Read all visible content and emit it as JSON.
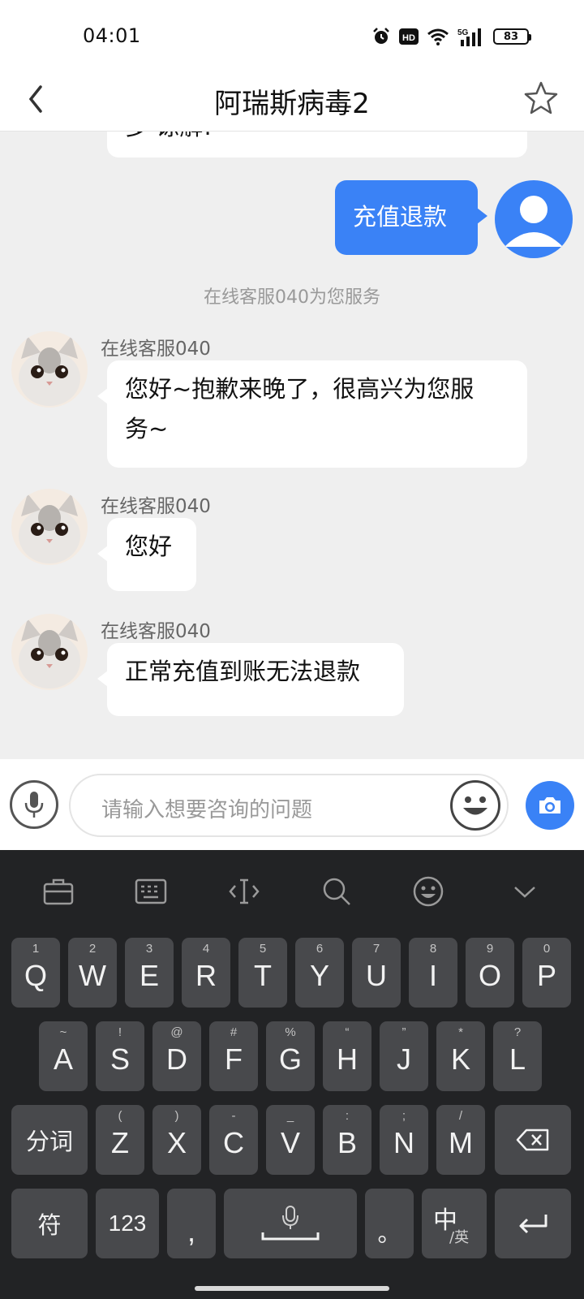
{
  "status_bar": {
    "time": "04:01",
    "icons": [
      "alarm-icon",
      "hd-icon",
      "wifi-icon",
      "signal-5g-icon"
    ],
    "network_label": "5G",
    "hd_label": "HD",
    "battery": "83"
  },
  "header": {
    "title": "阿瑞斯病毒2",
    "back_icon": "chevron-left-icon",
    "favorite_icon": "star-outline-icon"
  },
  "chat": {
    "partial_text": "多 谅解!",
    "user_message": "充值退款",
    "system_notice": "在线客服040为您服务",
    "messages": [
      {
        "sender": "在线客服040",
        "text_line1": "您好~抱歉来晚了，很高兴为您服",
        "text_line2": "务~"
      },
      {
        "sender": "在线客服040",
        "text": "您好"
      },
      {
        "sender": "在线客服040",
        "text": "正常充值到账无法退款"
      }
    ]
  },
  "input_bar": {
    "placeholder": "请输入想要咨询的问题",
    "voice_icon": "microphone-icon",
    "emoji_icon": "smiley-icon",
    "camera_icon": "camera-icon"
  },
  "keyboard": {
    "toolbar": [
      "toolbox-icon",
      "keyboard-icon",
      "cursor-icon",
      "search-icon",
      "emoji-icon",
      "collapse-icon"
    ],
    "row1": [
      {
        "k": "Q",
        "h": "1"
      },
      {
        "k": "W",
        "h": "2"
      },
      {
        "k": "E",
        "h": "3"
      },
      {
        "k": "R",
        "h": "4"
      },
      {
        "k": "T",
        "h": "5"
      },
      {
        "k": "Y",
        "h": "6"
      },
      {
        "k": "U",
        "h": "7"
      },
      {
        "k": "I",
        "h": "8"
      },
      {
        "k": "O",
        "h": "9"
      },
      {
        "k": "P",
        "h": "0"
      }
    ],
    "row2": [
      {
        "k": "A",
        "h": "~"
      },
      {
        "k": "S",
        "h": "!"
      },
      {
        "k": "D",
        "h": "@"
      },
      {
        "k": "F",
        "h": "#"
      },
      {
        "k": "G",
        "h": "%"
      },
      {
        "k": "H",
        "h": "“"
      },
      {
        "k": "J",
        "h": "”"
      },
      {
        "k": "K",
        "h": "*"
      },
      {
        "k": "L",
        "h": "?"
      }
    ],
    "row3": [
      {
        "k": "Z",
        "h": "("
      },
      {
        "k": "X",
        "h": ")"
      },
      {
        "k": "C",
        "h": "-"
      },
      {
        "k": "V",
        "h": "_"
      },
      {
        "k": "B",
        "h": ":"
      },
      {
        "k": "N",
        "h": ";"
      },
      {
        "k": "M",
        "h": "/"
      }
    ],
    "fenci": "分词",
    "fu": "符",
    "num": "123",
    "comma": ",",
    "period": "。",
    "zh": "中",
    "en_sub": "/英",
    "backspace_icon": "backspace-icon",
    "enter_icon": "enter-icon",
    "space_icon": "space-mic-icon"
  }
}
